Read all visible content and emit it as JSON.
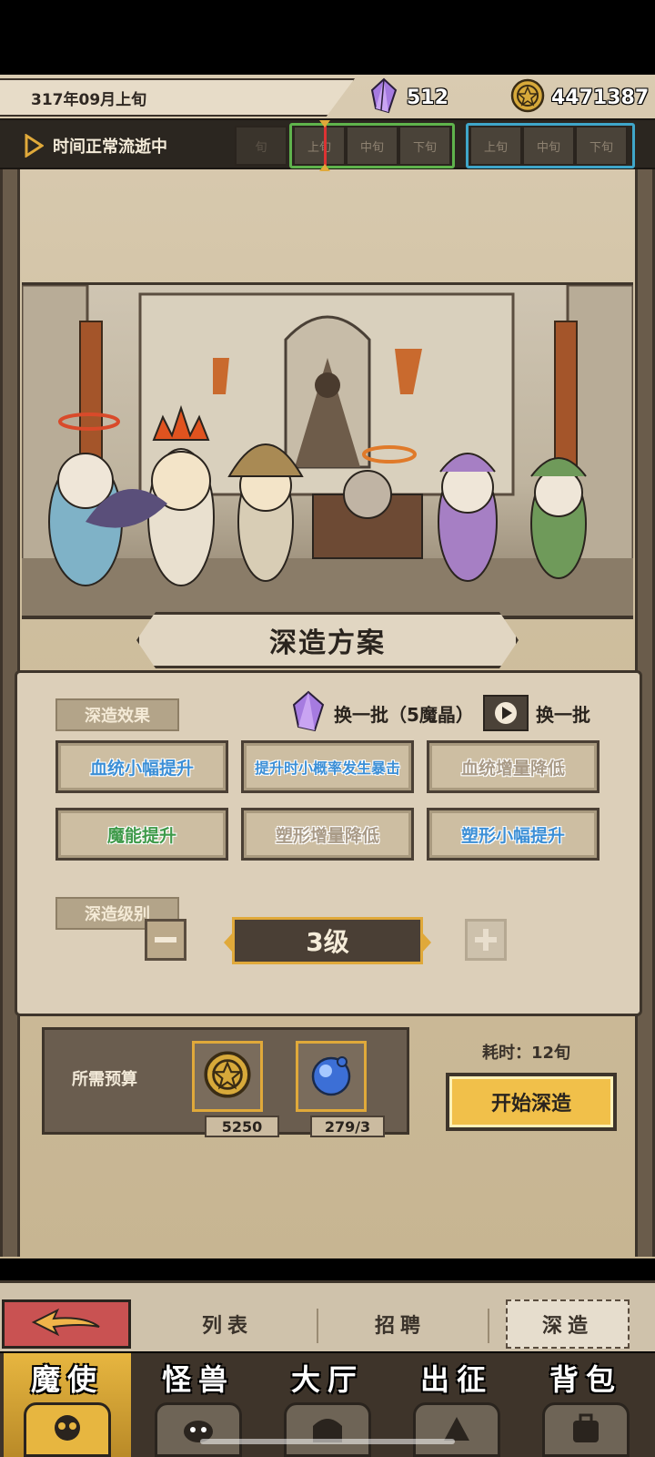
{
  "top_bar": {
    "date": "317年09月上旬",
    "crystals": "512",
    "gold": "4471387",
    "time_status": "时间正常流逝中",
    "segments": [
      "旬",
      "上旬",
      "中旬",
      "下旬",
      "上旬",
      "中旬",
      "下旬"
    ]
  },
  "scene": {
    "title": "深造方案"
  },
  "panel": {
    "effect_tag": "深造效果",
    "swap_crystal_label": "换一批（5魔晶）",
    "swap_video_label": "换一批",
    "effects": [
      {
        "label": "血统小幅提升",
        "color": "#3c8fd6"
      },
      {
        "label": "提升时小概率发生暴击",
        "color": "#3c8fd6"
      },
      {
        "label": "血统增量降低",
        "color": "#a99a86"
      },
      {
        "label": "魔能提升",
        "color": "#3f9a4a"
      },
      {
        "label": "塑形增量降低",
        "color": "#a99a86"
      },
      {
        "label": "塑形小幅提升",
        "color": "#3c8fd6"
      }
    ],
    "level_tag": "深造级别",
    "level_value": "3级"
  },
  "budget": {
    "label": "所需预算",
    "gold_cost": "5250",
    "orb_cost": "279/3"
  },
  "time_cost": "耗时：12旬",
  "start_button": "开始深造",
  "tabs": {
    "list": "列表",
    "recruit": "招聘",
    "study": "深造"
  },
  "nav": [
    {
      "label": "魔使",
      "icon": "demon-skull-icon"
    },
    {
      "label": "怪兽",
      "icon": "monster-icon"
    },
    {
      "label": "大厅",
      "icon": "hall-icon"
    },
    {
      "label": "出征",
      "icon": "expedition-icon"
    },
    {
      "label": "背包",
      "icon": "backpack-icon"
    }
  ],
  "colors": {
    "accent_gold": "#e0a93a",
    "start_button": "#f1c04a",
    "back_button": "#c95252",
    "parchment": "#dccfb9",
    "dark_brown": "#3e352b"
  }
}
